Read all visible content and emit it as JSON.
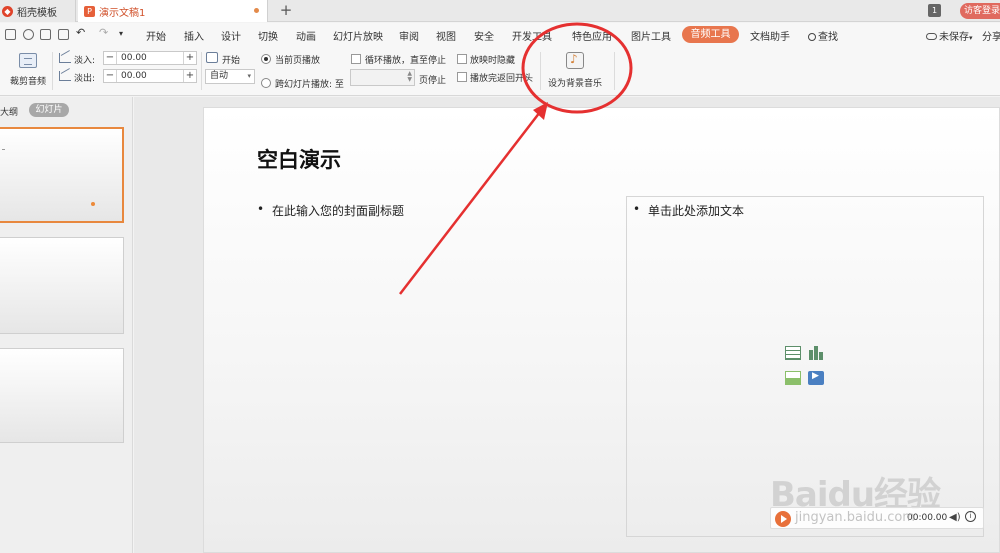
{
  "tabs": {
    "docer_label": "稻壳模板",
    "document_label": "演示文稿1",
    "new_tab_symbol": "+",
    "window_count": "1",
    "visitor_login": "访客登录"
  },
  "menu": {
    "items": [
      "开始",
      "插入",
      "设计",
      "切换",
      "动画",
      "幻灯片放映",
      "审阅",
      "视图",
      "安全",
      "开发工具",
      "特色应用",
      "图片工具"
    ],
    "active_label": "音频工具",
    "doc_assistant": "文档助手",
    "search": "查找",
    "unsaved": "未保存",
    "share": "分享"
  },
  "ribbon": {
    "trim_audio": "裁剪音频",
    "fade_in_label": "淡入:",
    "fade_in_value": "00.00",
    "fade_out_label": "淡出:",
    "fade_out_value": "00.00",
    "minus": "−",
    "plus": "+",
    "start_label": "开始",
    "start_select": "自动",
    "current_page_play": "当前页播放",
    "cross_slide_play": "跨幻灯片播放: 至",
    "page_stop": "页停止",
    "loop_play": "循环播放，直至停止",
    "hide_when_playing": "放映时隐藏",
    "rewind_after": "播放完返回开头",
    "set_bgm": "设为背景音乐"
  },
  "left_pane": {
    "outline_tab": "大纲",
    "slides_tab": "幻灯片"
  },
  "slide": {
    "title": "空白演示",
    "subtitle_bullet": "在此输入您的封面副标题",
    "content_bullet": "单击此处添加文本",
    "bullet_symbol": "•"
  },
  "player": {
    "time": "00:00.00"
  },
  "watermark": {
    "logo_text": "Baidu经验",
    "url": "jingyan.baidu.com"
  },
  "colors": {
    "accent_orange": "#e8764e",
    "annotation_red": "#e53030",
    "visitor_button": "#e06a5f"
  }
}
